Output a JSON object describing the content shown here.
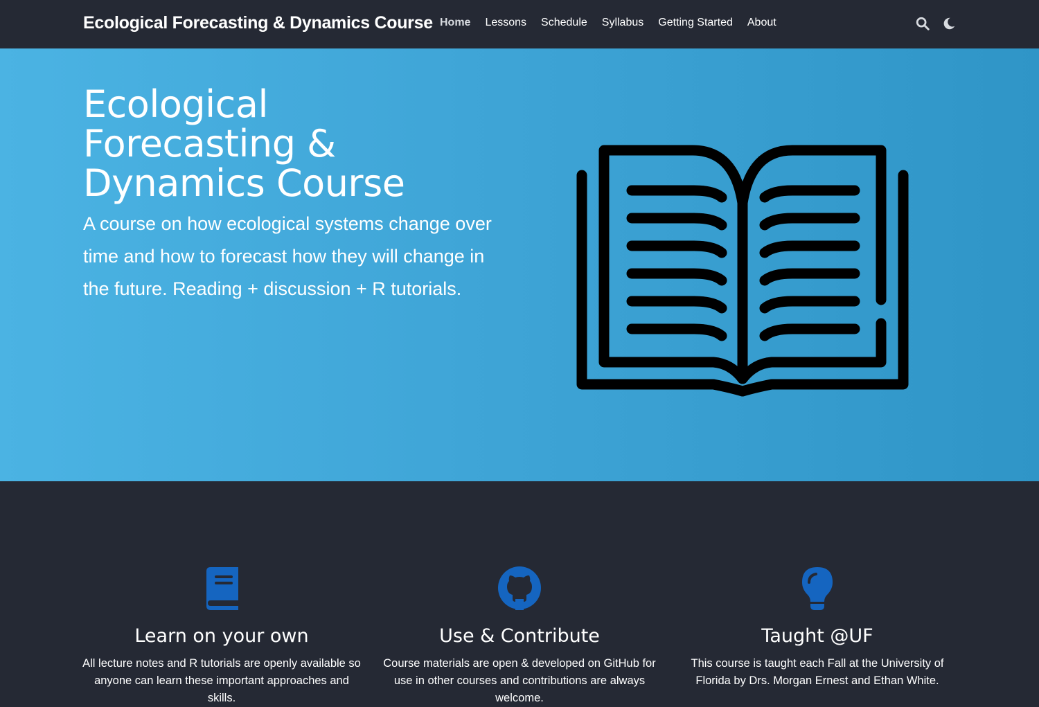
{
  "navbar": {
    "brand": "Ecological Forecasting & Dynamics Course",
    "links": [
      {
        "label": "Home"
      },
      {
        "label": "Lessons"
      },
      {
        "label": "Schedule"
      },
      {
        "label": "Syllabus"
      },
      {
        "label": "Getting Started"
      },
      {
        "label": "About"
      }
    ],
    "active": "Home",
    "icons": [
      "search-icon",
      "moon-icon"
    ]
  },
  "hero": {
    "title": "Ecological Forecasting & Dynamics Course",
    "subtitle": "A course on how ecological systems change over time and how to forecast how they will change in the future. Reading + discussion + R tutorials.",
    "image_icon": "open-book-icon"
  },
  "features": [
    {
      "icon": "book-icon",
      "title": "Learn on your own",
      "text": "All lecture notes and R tutorials are openly available so anyone can learn these important approaches and skills."
    },
    {
      "icon": "github-icon",
      "title": "Use & Contribute",
      "text": "Course materials are open & developed on GitHub for use in other courses and contributions are always welcome."
    },
    {
      "icon": "lightbulb-icon",
      "title": "Taught @UF",
      "text": "This course is taught each Fall at the University of Florida by Drs. Morgan Ernest and Ethan White."
    }
  ],
  "colors": {
    "navbar_bg": "#252934",
    "hero_gradient_start": "#4bb3e3",
    "hero_gradient_end": "#2f95c7",
    "feature_icon": "#1565c0",
    "text": "#ffffff"
  }
}
